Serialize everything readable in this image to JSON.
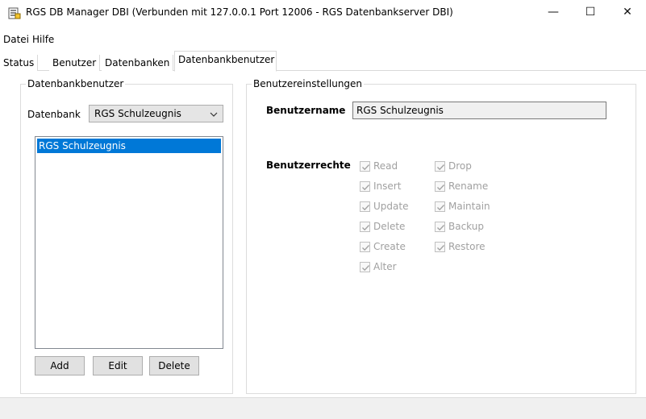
{
  "window": {
    "title": "RGS DB Manager DBI (Verbunden mit 127.0.0.1  Port 12006 - RGS Datenbankserver DBI)",
    "minimize_glyph": "—",
    "maximize_glyph": "☐",
    "close_glyph": "✕"
  },
  "menu": {
    "items": [
      "Datei",
      "Hilfe"
    ]
  },
  "tabs": [
    {
      "label": "Status"
    },
    {
      "label": "Benutzer"
    },
    {
      "label": "Datenbanken"
    },
    {
      "label": "Datenbankbenutzer",
      "active": true
    }
  ],
  "left_group": {
    "caption": "Datenbankbenutzer",
    "db_label": "Datenbank",
    "db_selected": "RGS Schulzeugnis",
    "list_items": [
      "RGS Schulzeugnis"
    ],
    "buttons": {
      "add": "Add",
      "edit": "Edit",
      "delete": "Delete"
    }
  },
  "right_group": {
    "caption": "Benutzereinstellungen",
    "username_label": "Benutzername",
    "username_value": "RGS Schulzeugnis",
    "rights_label": "Benutzerrechte",
    "rights_col1": [
      "Read",
      "Insert",
      "Update",
      "Delete",
      "Create",
      "Alter"
    ],
    "rights_col2": [
      "Drop",
      "Rename",
      "Maintain",
      "Backup",
      "Restore"
    ],
    "rights_checked": true
  }
}
